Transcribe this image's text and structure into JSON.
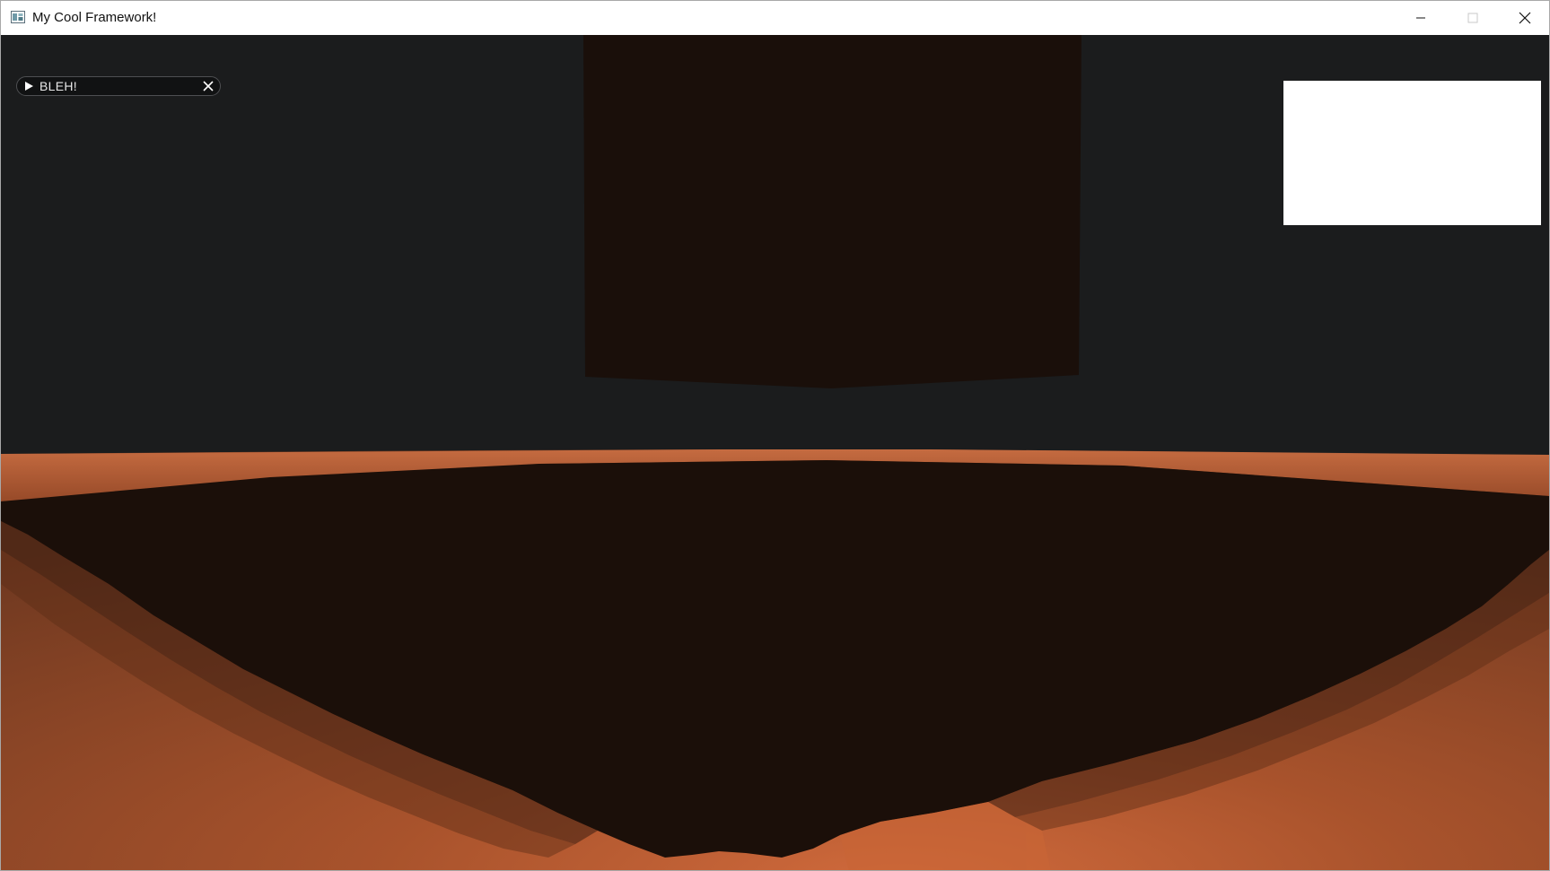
{
  "window": {
    "title": "My Cool Framework!",
    "icon": "app-window-icon",
    "controls": {
      "minimize_icon": "minimize-icon",
      "maximize_icon": "maximize-icon",
      "close_icon": "close-icon"
    }
  },
  "overlay": {
    "header_label": "BLEH!",
    "arrow_icon": "collapsed-arrow-icon",
    "close_icon": "close-icon"
  },
  "colors": {
    "background": "#1b1c1d",
    "floor_lit": "#c05f34",
    "floor_shadow": "#1b0f09",
    "cube_dark": "#1a0f0a",
    "preview_panel": "#ffffff"
  }
}
